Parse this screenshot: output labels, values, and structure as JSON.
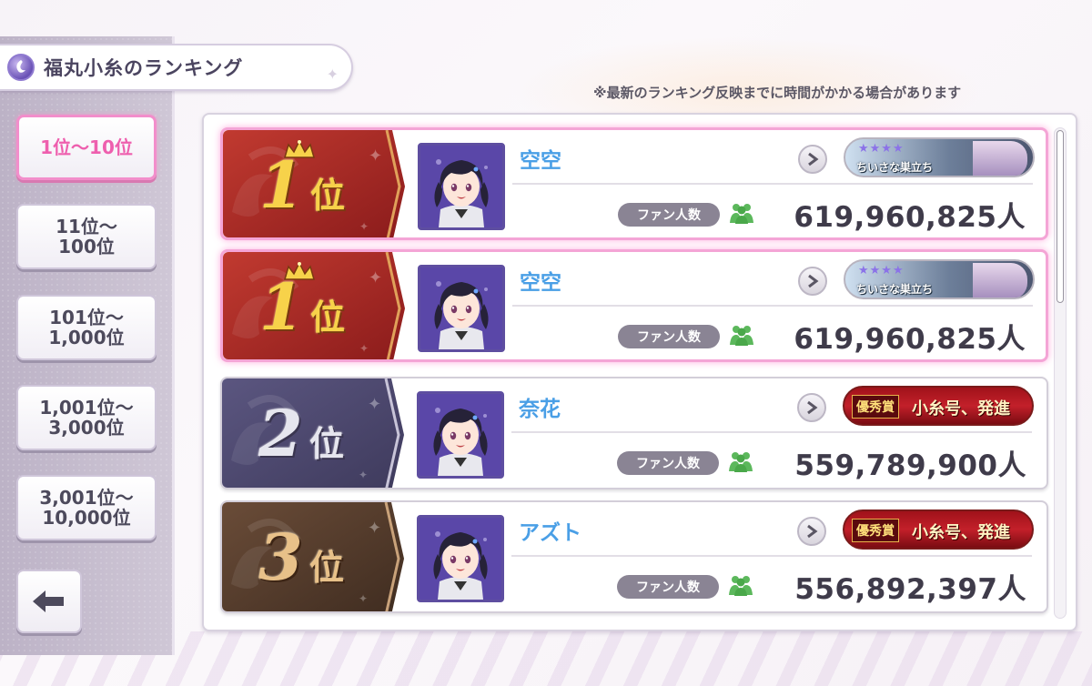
{
  "header": {
    "title": "福丸小糸のランキング",
    "notice": "※最新のランキング反映までに時間がかかる場合があります"
  },
  "sidebar": {
    "ranges": [
      {
        "label": "1位〜10位",
        "active": true
      },
      {
        "label": "11位〜\n100位",
        "active": false
      },
      {
        "label": "101位〜\n1,000位",
        "active": false
      },
      {
        "label": "1,001位〜\n3,000位",
        "active": false
      },
      {
        "label": "3,001位〜\n10,000位",
        "active": false
      }
    ]
  },
  "ranking": {
    "fan_label": "ファン人数",
    "rank_suffix": "位",
    "rows": [
      {
        "rank": "1",
        "tier": "gold",
        "name": "空空",
        "fans": "619,960,825人",
        "plate": "blue",
        "plate_stars": "★★★★",
        "plate_text": "ちいさな巣立ち"
      },
      {
        "rank": "1",
        "tier": "gold",
        "name": "空空",
        "fans": "619,960,825人",
        "plate": "blue",
        "plate_stars": "★★★★",
        "plate_text": "ちいさな巣立ち"
      },
      {
        "rank": "2",
        "tier": "silver",
        "name": "奈花",
        "fans": "559,789,900人",
        "plate": "red",
        "plate_award": "優秀賞",
        "plate_text": "小糸号、発進"
      },
      {
        "rank": "3",
        "tier": "bronze",
        "name": "アズト",
        "fans": "556,892,397人",
        "plate": "red",
        "plate_award": "優秀賞",
        "plate_text": "小糸号、発進"
      }
    ]
  },
  "colors": {
    "active_pink": "#ee5fae",
    "name_blue": "#4a9fe6",
    "gold_badge": "#b02a2a",
    "silver_badge": "#4d4870",
    "bronze_badge": "#5a4232"
  }
}
